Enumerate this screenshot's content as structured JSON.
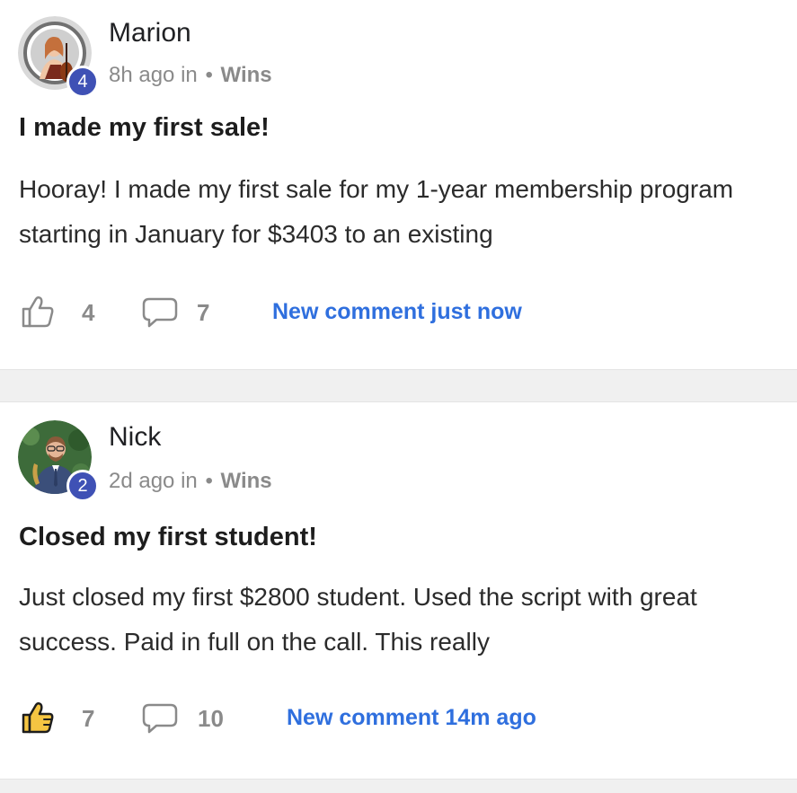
{
  "posts": [
    {
      "author": "Marion",
      "level": "4",
      "time": "8h ago in",
      "separator": "•",
      "category": "Wins",
      "title": "I made my first sale!",
      "body": "Hooray! I made my first sale for my 1-year membership program starting in January for $3403 to an existing",
      "likes": "4",
      "comments": "7",
      "new_comment": "New comment just now",
      "liked": false
    },
    {
      "author": "Nick",
      "level": "2",
      "time": "2d ago in",
      "separator": "•",
      "category": "Wins",
      "title": "Closed my first student!",
      "body": "Just closed my first $2800 student. Used the script with great success. Paid in full on the call. This really",
      "likes": "7",
      "comments": "10",
      "new_comment": "New comment 14m ago",
      "liked": true
    }
  ],
  "icons": {
    "like": "thumbs-up-icon",
    "comment": "speech-bubble-icon"
  },
  "colors": {
    "accent": "#2f6fde",
    "badge": "#3f51b5",
    "liked": "#f5c542",
    "muted": "#8a8a8a"
  }
}
